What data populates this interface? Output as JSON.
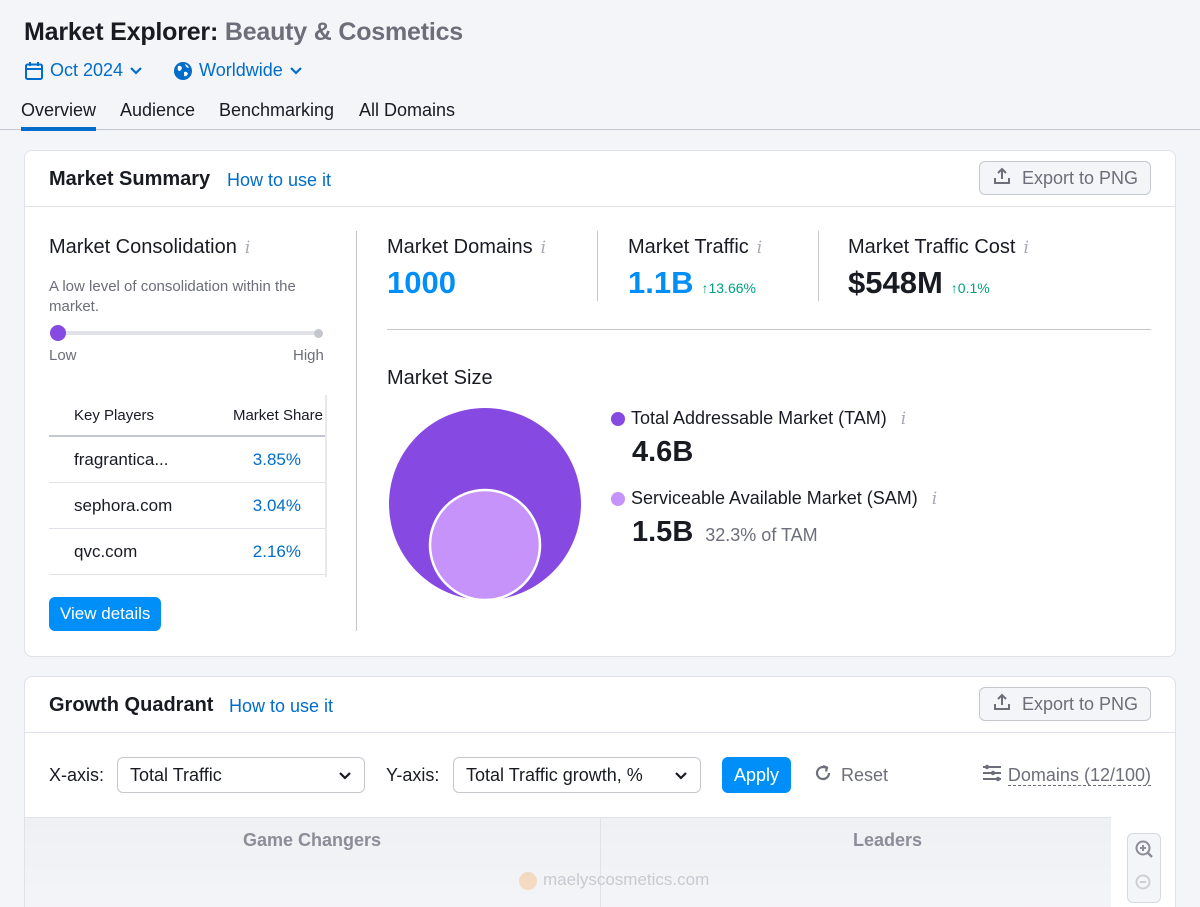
{
  "header": {
    "title_main": "Market Explorer:",
    "title_sub": "Beauty & Cosmetics",
    "date_filter": "Oct 2024",
    "region_filter": "Worldwide"
  },
  "tabs": [
    {
      "label": "Overview",
      "active": true
    },
    {
      "label": "Audience",
      "active": false
    },
    {
      "label": "Benchmarking",
      "active": false
    },
    {
      "label": "All Domains",
      "active": false
    }
  ],
  "market_summary": {
    "title": "Market Summary",
    "how_to": "How to use it",
    "export_label": "Export to PNG",
    "consolidation": {
      "title": "Market Consolidation",
      "description": "A low level of consolidation within the market.",
      "level": 0,
      "low_label": "Low",
      "high_label": "High"
    },
    "key_players": {
      "headers": [
        "Key Players",
        "Market Share"
      ],
      "rows": [
        {
          "domain": "fragrantica...",
          "share": "3.85%"
        },
        {
          "domain": "sephora.com",
          "share": "3.04%"
        },
        {
          "domain": "qvc.com",
          "share": "2.16%"
        }
      ],
      "view_details_label": "View details"
    },
    "metrics": [
      {
        "label": "Market Domains",
        "value": "1000",
        "delta": ""
      },
      {
        "label": "Market Traffic",
        "value": "1.1B",
        "delta": "↑13.66%"
      },
      {
        "label": "Market Traffic Cost",
        "value": "$548M",
        "delta": "↑0.1%"
      }
    ],
    "market_size": {
      "title": "Market Size",
      "tam_label": "Total Addressable Market (TAM)",
      "tam_value": "4.6B",
      "tam_color": "#8649e1",
      "sam_label": "Serviceable Available Market (SAM)",
      "sam_value": "1.5B",
      "sam_pct": "32.3% of TAM",
      "sam_color": "#c593fa"
    }
  },
  "growth_quadrant": {
    "title": "Growth Quadrant",
    "how_to": "How to use it",
    "export_label": "Export to PNG",
    "x_axis_label": "X-axis:",
    "x_axis_value": "Total Traffic",
    "y_axis_label": "Y-axis:",
    "y_axis_value": "Total Traffic growth, %",
    "apply_label": "Apply",
    "reset_label": "Reset",
    "domains_label": "Domains (12/100)",
    "quadrants": [
      "Game Changers",
      "Leaders"
    ],
    "bubble_label": "maelyscosmetics.com"
  },
  "colors": {
    "accent": "#006dca",
    "primary_button": "#008ff8",
    "positive": "#009f81"
  }
}
